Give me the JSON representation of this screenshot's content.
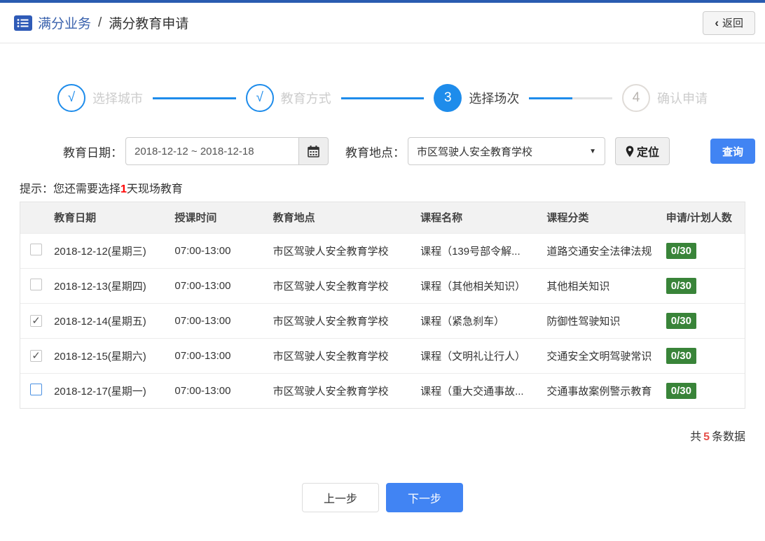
{
  "header": {
    "title_primary": "满分业务",
    "title_separator": "/",
    "title_secondary": "满分教育申请",
    "back_chevron": "‹",
    "back_label": "返回"
  },
  "steps": [
    {
      "mark": "√",
      "label": "选择城市",
      "state": "done"
    },
    {
      "mark": "√",
      "label": "教育方式",
      "state": "done"
    },
    {
      "mark": "3",
      "label": "选择场次",
      "state": "active"
    },
    {
      "mark": "4",
      "label": "确认申请",
      "state": "pending"
    }
  ],
  "filters": {
    "date_label": "教育日期：",
    "date_value": "2018-12-12 ~ 2018-12-18",
    "location_label": "教育地点：",
    "location_value": "市区驾驶人安全教育学校",
    "dropdown_arrow": "▼",
    "locate_label": "定位",
    "search_label": "查询"
  },
  "hint": {
    "prefix": "提示：您还需要选择",
    "count": "1",
    "suffix": "天现场教育"
  },
  "table": {
    "headers": [
      "教育日期",
      "授课时间",
      "教育地点",
      "课程名称",
      "课程分类",
      "申请/计划人数"
    ],
    "checkmark": "✓",
    "rows": [
      {
        "checked": false,
        "highlight": false,
        "date": "2018-12-12(星期三)",
        "time": "07:00-13:00",
        "place": "市区驾驶人安全教育学校",
        "course": "课程（139号部令解...",
        "category": "道路交通安全法律法规",
        "quota": "0/30"
      },
      {
        "checked": false,
        "highlight": false,
        "date": "2018-12-13(星期四)",
        "time": "07:00-13:00",
        "place": "市区驾驶人安全教育学校",
        "course": "课程（其他相关知识）",
        "category": "其他相关知识",
        "quota": "0/30"
      },
      {
        "checked": true,
        "highlight": false,
        "date": "2018-12-14(星期五)",
        "time": "07:00-13:00",
        "place": "市区驾驶人安全教育学校",
        "course": "课程（紧急刹车）",
        "category": "防御性驾驶知识",
        "quota": "0/30"
      },
      {
        "checked": true,
        "highlight": false,
        "date": "2018-12-15(星期六)",
        "time": "07:00-13:00",
        "place": "市区驾驶人安全教育学校",
        "course": "课程（文明礼让行人）",
        "category": "交通安全文明驾驶常识",
        "quota": "0/30"
      },
      {
        "checked": false,
        "highlight": true,
        "date": "2018-12-17(星期一)",
        "time": "07:00-13:00",
        "place": "市区驾驶人安全教育学校",
        "course": "课程（重大交通事故...",
        "category": "交通事故案例警示教育",
        "quota": "0/30"
      }
    ]
  },
  "summary": {
    "prefix": "共",
    "count": "5",
    "suffix": "条数据"
  },
  "footer": {
    "prev_label": "上一步",
    "next_label": "下一步"
  },
  "colors": {
    "accent_blue": "#1e8ceb",
    "button_blue": "#4184f3",
    "brand_blue": "#2a5cb0",
    "badge_green": "#398439",
    "alert_red": "#ff0000",
    "count_red": "#e6504a"
  }
}
